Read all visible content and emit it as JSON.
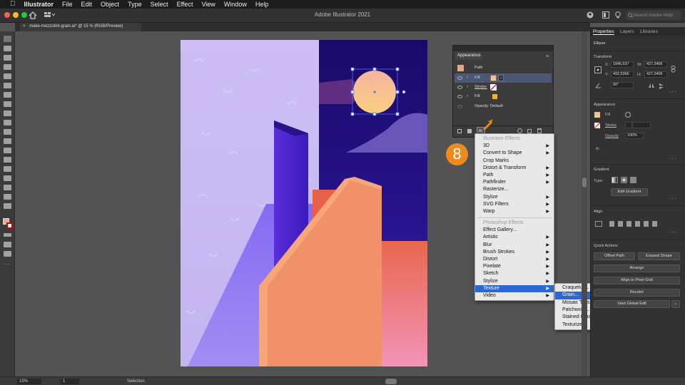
{
  "menubar": {
    "apple": "",
    "app": "Illustrator",
    "items": [
      "File",
      "Edit",
      "Object",
      "Type",
      "Select",
      "Effect",
      "View",
      "Window",
      "Help"
    ]
  },
  "titlebar": {
    "title": "Adobe Illustrator 2021",
    "search_placeholder": "Search Adobe Help"
  },
  "document": {
    "tab_label": "make-mezzotint-grain.ai* @ 15 % (RGB/Preview)",
    "tab_close": "×"
  },
  "appearance_panel": {
    "title": "Appearance",
    "object": "Path",
    "rows": [
      {
        "label": "Fill:",
        "type": "fill-gradient"
      },
      {
        "label": "Stroke:",
        "type": "stroke-none"
      },
      {
        "label": "Fill:",
        "type": "fill-solid"
      },
      {
        "label": "Opacity: Default",
        "type": "opacity"
      }
    ],
    "fx_label": "fx."
  },
  "effect_menu": {
    "illustrator_header": "Illustrator Effects",
    "illustrator_items": [
      {
        "label": "3D",
        "sub": true
      },
      {
        "label": "Convert to Shape",
        "sub": true
      },
      {
        "label": "Crop Marks",
        "sub": false
      },
      {
        "label": "Distort & Transform",
        "sub": true
      },
      {
        "label": "Path",
        "sub": true
      },
      {
        "label": "Pathfinder",
        "sub": true
      },
      {
        "label": "Rasterize...",
        "sub": false
      },
      {
        "label": "Stylize",
        "sub": true
      },
      {
        "label": "SVG Filters",
        "sub": true
      },
      {
        "label": "Warp",
        "sub": true
      }
    ],
    "photoshop_header": "Photoshop Effects",
    "photoshop_items": [
      {
        "label": "Effect Gallery...",
        "sub": false
      },
      {
        "label": "Artistic",
        "sub": true
      },
      {
        "label": "Blur",
        "sub": true
      },
      {
        "label": "Brush Strokes",
        "sub": true
      },
      {
        "label": "Distort",
        "sub": true
      },
      {
        "label": "Pixelate",
        "sub": true
      },
      {
        "label": "Sketch",
        "sub": true
      },
      {
        "label": "Stylize",
        "sub": true
      },
      {
        "label": "Texture",
        "sub": true,
        "selected": true
      },
      {
        "label": "Video",
        "sub": true
      }
    ],
    "texture_submenu": [
      {
        "label": "Craquelure..."
      },
      {
        "label": "Grain...",
        "selected": true
      },
      {
        "label": "Mosaic Tiles..."
      },
      {
        "label": "Patchwork..."
      },
      {
        "label": "Stained Glass..."
      },
      {
        "label": "Texturizer..."
      }
    ]
  },
  "step_badge": "8",
  "properties_panel": {
    "tabs": [
      "Properties",
      "Layers",
      "Libraries"
    ],
    "object_type": "Ellipse",
    "transform": {
      "title": "Transform",
      "x_label": "X:",
      "x_value": "1846,537",
      "y_label": "Y:",
      "y_value": "492,5366",
      "w_label": "W:",
      "w_value": "427,3406",
      "h_label": "H:",
      "h_value": "427,3406",
      "angle_value": "90°"
    },
    "appearance": {
      "title": "Appearance",
      "fill_label": "Fill",
      "stroke_label": "Stroke",
      "opacity_label": "Opacity",
      "opacity_value": "100%",
      "fx_label": "fx."
    },
    "gradient": {
      "title": "Gradient",
      "type_label": "Type:",
      "edit_button": "Edit Gradient"
    },
    "align": {
      "title": "Align"
    },
    "quick_actions": {
      "title": "Quick Actions",
      "offset_path": "Offset Path",
      "expand_shape": "Expand Shape",
      "arrange": "Arrange",
      "align_pixel": "Align to Pixel Grid",
      "recolor": "Recolor",
      "global_edit": "Start Global Edit"
    }
  },
  "statusbar": {
    "zoom": "15%",
    "artboard": "1",
    "tool": "Selection"
  },
  "colors": {
    "accent": "#2968d6",
    "badge": "#f08a1a",
    "night": "#1e0f6e",
    "orange": "#f0916a"
  }
}
